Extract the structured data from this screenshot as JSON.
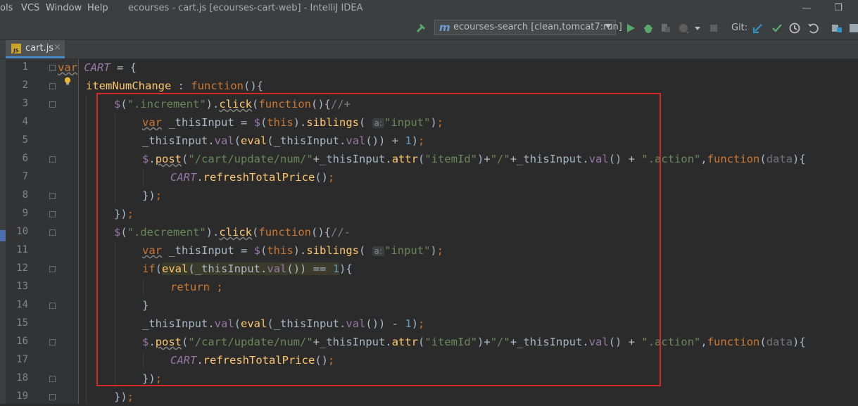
{
  "menu": {
    "items": [
      "ols",
      "VCS",
      "Window",
      "Help"
    ],
    "window_title": "ecourses - cart.js [ecourses-cart-web] - IntelliJ IDEA"
  },
  "toolbar": {
    "run_config": "ecourses-search [clean,tomcat7:run]",
    "git_label": "Git:"
  },
  "tab": {
    "label": "cart.js",
    "icon_text": "JS"
  },
  "editor": {
    "line_numbers": [
      "1",
      "2",
      "3",
      "4",
      "5",
      "6",
      "7",
      "8",
      "9",
      "10",
      "11",
      "12",
      "13",
      "14",
      "15",
      "16",
      "17",
      "18",
      "19"
    ],
    "param_hint": "a:",
    "tokens": {
      "var": "var",
      "cart": "CART",
      "eq_open": " = {",
      "itemNumChange": "itemNumChange",
      "colon": " : ",
      "function": "function",
      "paren_open_brace": "(){",
      "dollar": "$",
      "sel_increment": "\".increment\"",
      "sel_decrement": "\".decrement\"",
      "click": "click",
      "comment_plus": "//+",
      "comment_minus": "//-",
      "thisInput_decl": " _thisInput = ",
      "this": "this",
      "siblings": "siblings",
      "str_input": "\"input\"",
      "thisInput": "_thisInput",
      "val": "val",
      "eval": "eval",
      "one": "1",
      "post": "post",
      "url": "\"/cart/update/num/\"",
      "attr": "attr",
      "itemId": "\"itemId\"",
      "slash": "\"/\"",
      "action": "\".action\"",
      "data": "data",
      "refresh": "refreshTotalPrice",
      "if": "if",
      "return": "return"
    }
  }
}
